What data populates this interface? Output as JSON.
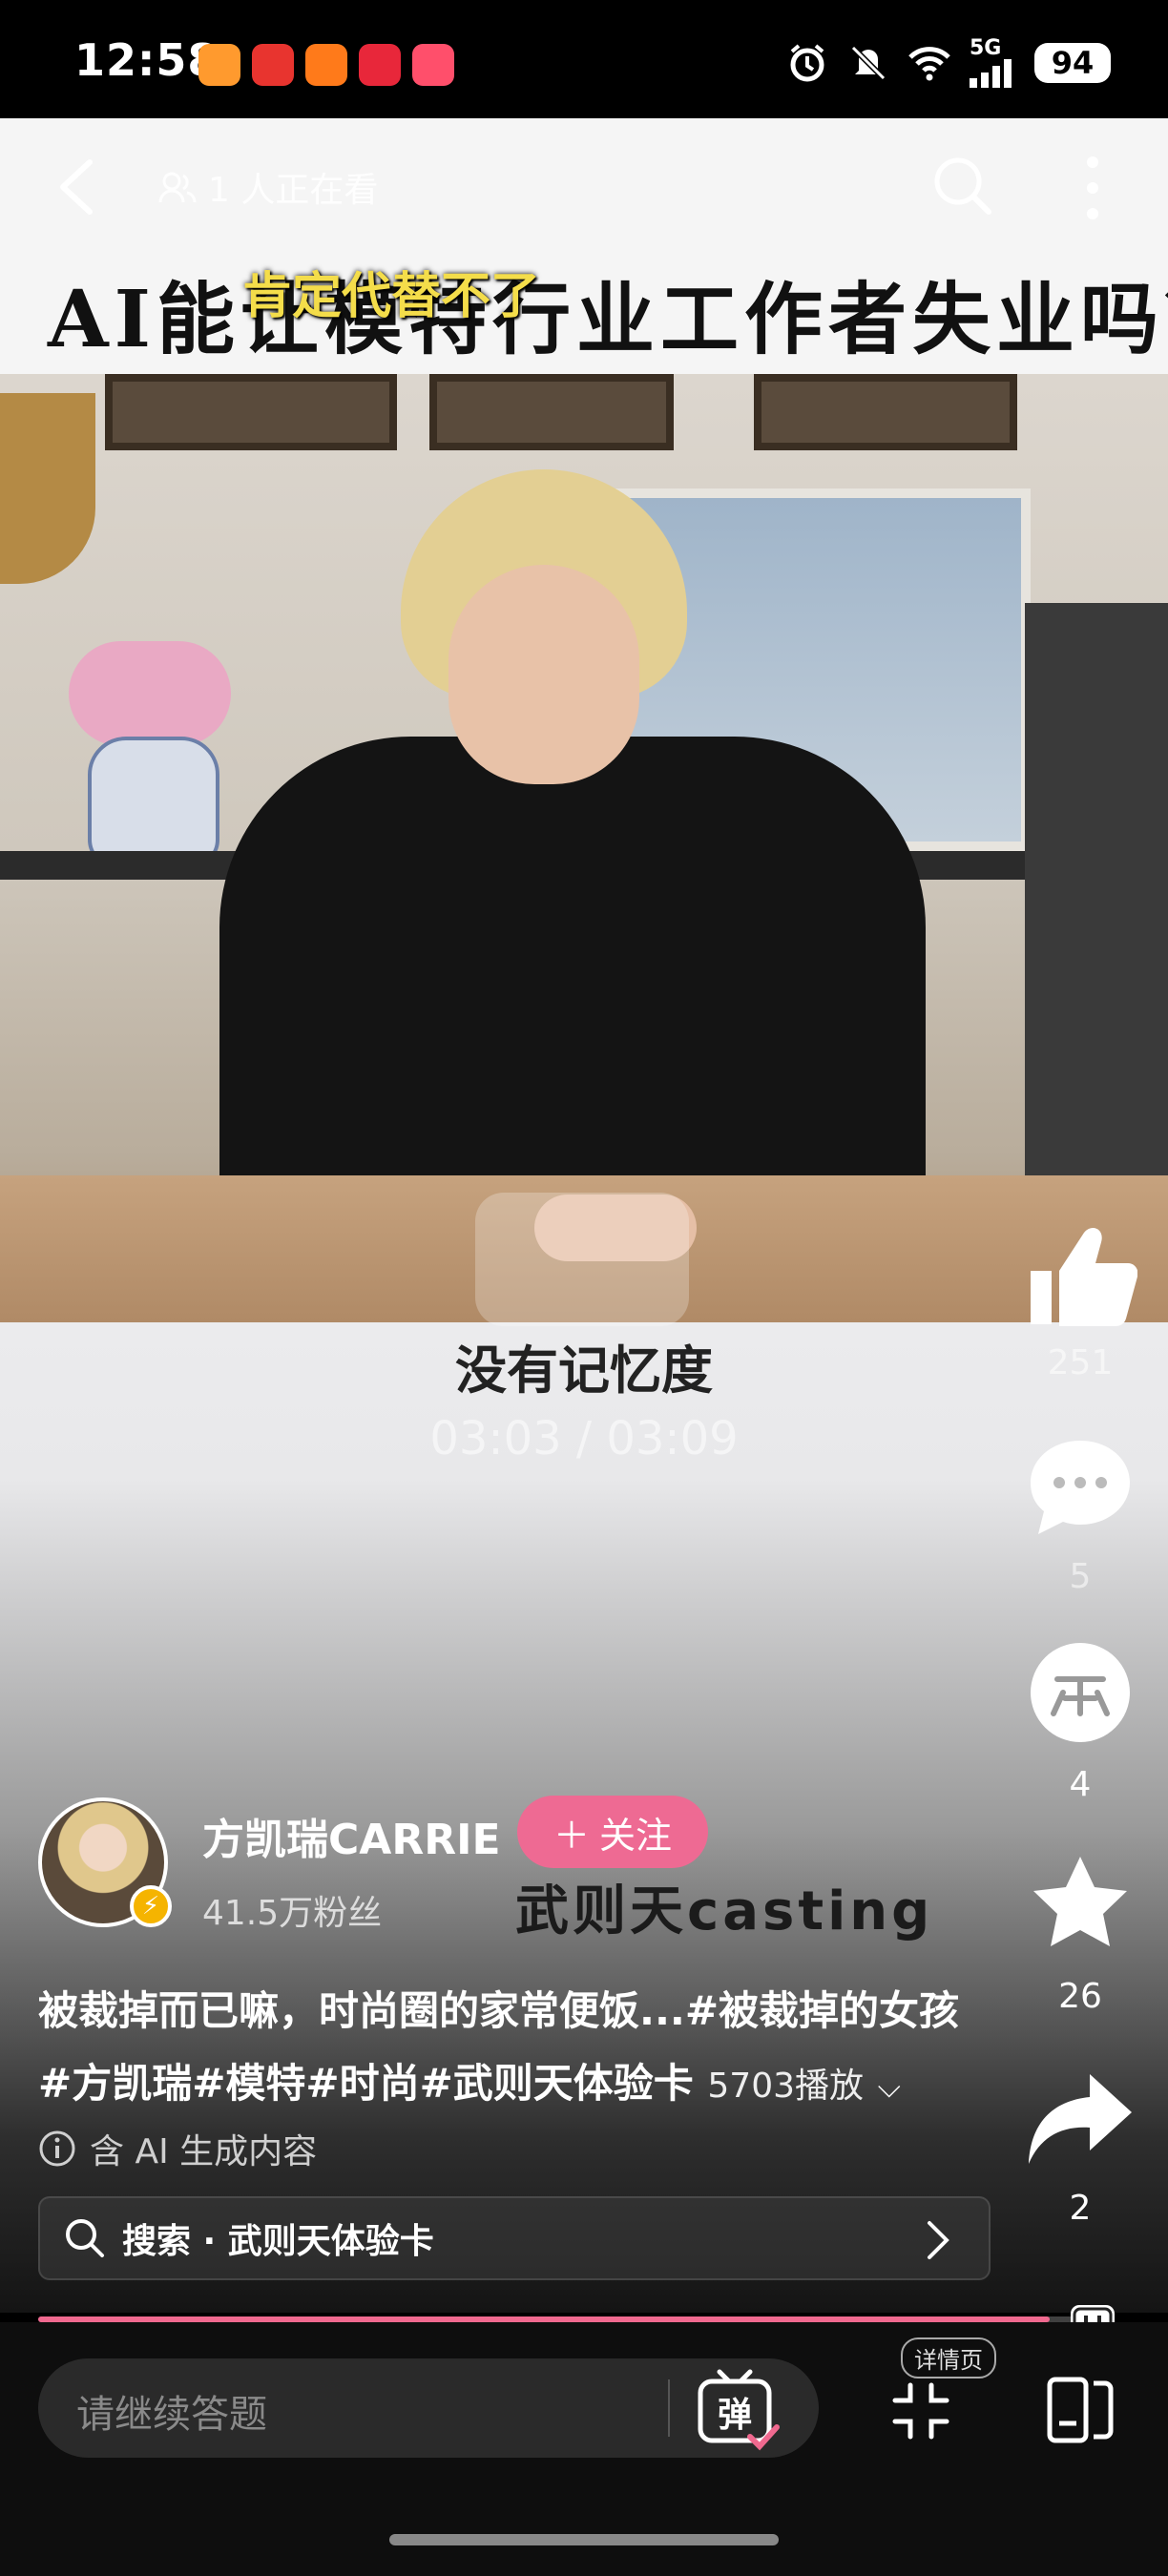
{
  "status_bar": {
    "time": "12:58",
    "network": "5G",
    "battery": "94",
    "app_icon_colors": [
      "#ff9a2e",
      "#e8342f",
      "#ff7a1a",
      "#e8273a",
      "#ff4f6b"
    ]
  },
  "top_nav": {
    "viewers": "1 人正在看"
  },
  "video": {
    "title_overlay": "AI能让模特行业工作者失业吗？",
    "subtitle_overlay": "肯定代替不了",
    "caption": "没有记忆度",
    "time_display": "03:03 / 03:09",
    "progress": 0.96
  },
  "rail": {
    "likes": "251",
    "comments": "5",
    "coins": "4",
    "favorites": "26",
    "shares": "2"
  },
  "author": {
    "name": "方凯瑞CARRIE",
    "follow_label": "关注",
    "fans": "41.5万粉丝",
    "watermark": "武则天casting"
  },
  "description": {
    "text": "被裁掉而已嘛，时尚圈的家常便饭...#被裁掉的女孩#方凯瑞#模特#时尚#武则天体验卡",
    "plays": "5703播放"
  },
  "ai_note": "含 AI 生成内容",
  "search_suggestion": "搜索 · 武则天体验卡",
  "bottom_bar": {
    "comment_placeholder": "请继续答题",
    "danmaku_label": "弹",
    "detail_label": "详情页"
  },
  "colors": {
    "accent": "#ee6a93",
    "progress": "#f0698f",
    "subtitle": "#f4dd4a"
  }
}
